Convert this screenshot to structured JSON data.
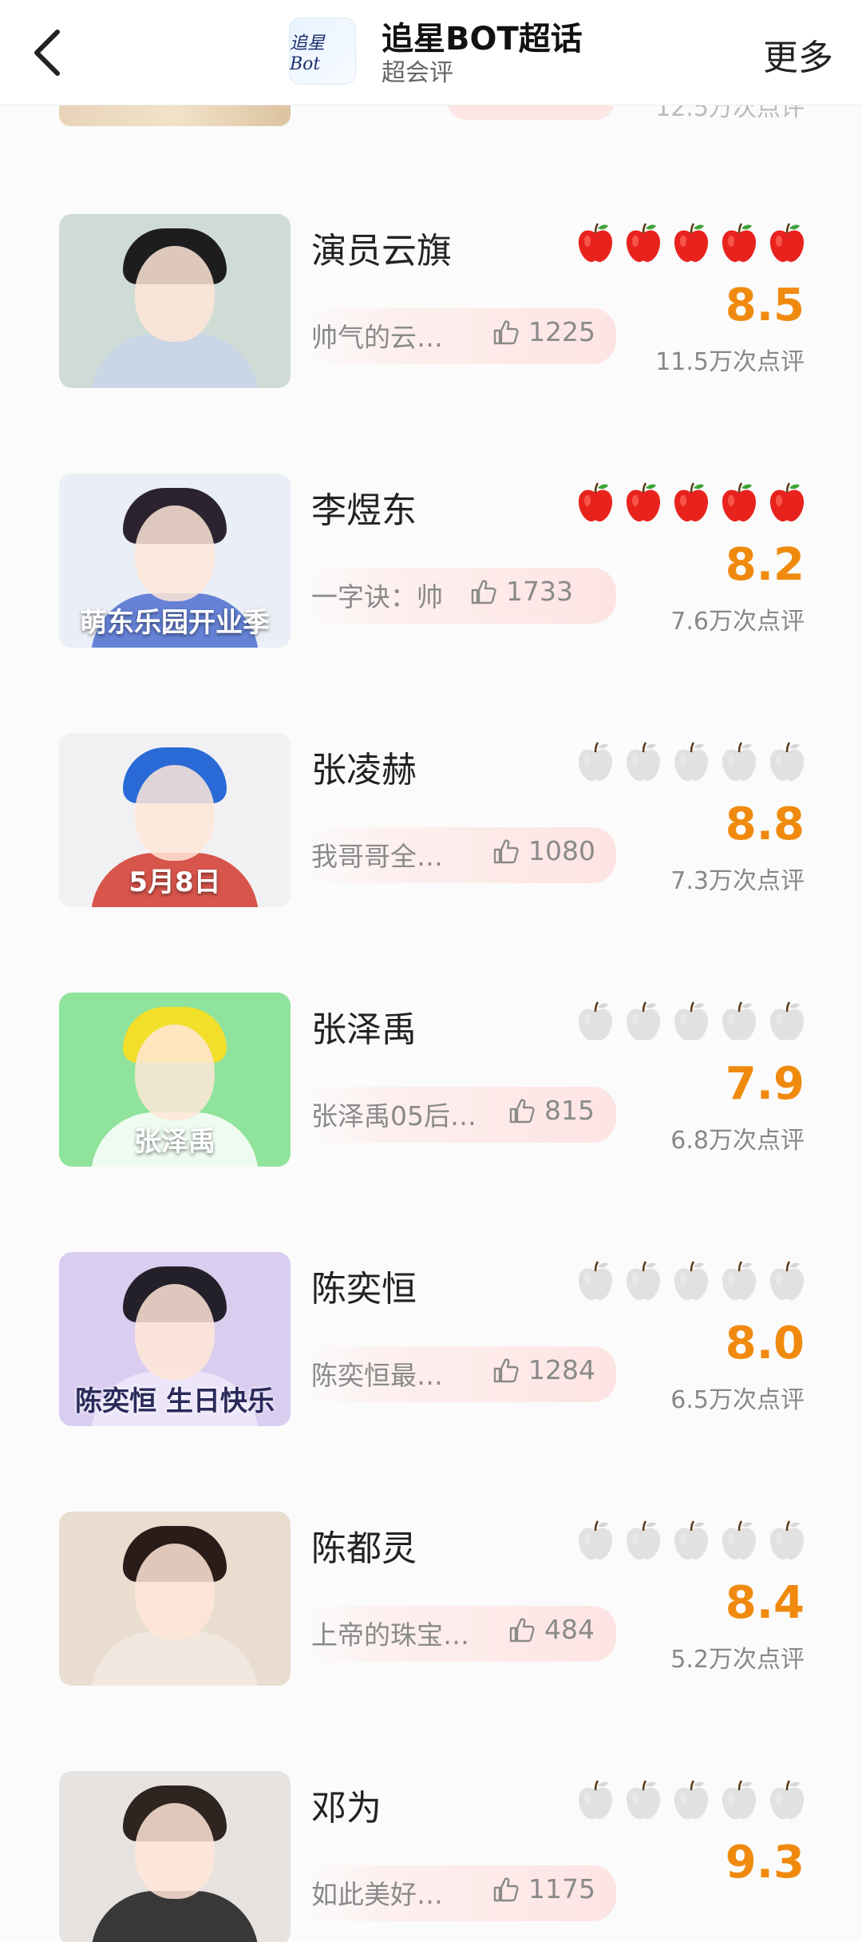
{
  "header": {
    "title": "追星BOT超话",
    "subtitle": "超会评",
    "more_label": "更多",
    "logo_text": "追星Bot"
  },
  "partial_item": {
    "reviews": "12.5万次点评"
  },
  "items": [
    {
      "name": "演员云旗",
      "apples_filled": 5,
      "review": "帅气的云…",
      "likes": "1225",
      "score": "8.5",
      "reviews": "11.5万次点评",
      "thumb_caption": "",
      "colors": {
        "bg": "#cfdcd6",
        "hair": "#1d1d1f",
        "body": "#c9d3e8"
      }
    },
    {
      "name": "李煜东",
      "apples_filled": 5,
      "review": "一字诀：帅",
      "likes": "1733",
      "score": "8.2",
      "reviews": "7.6万次点评",
      "thumb_caption": "萌东乐园开业季",
      "colors": {
        "bg": "#eaeef6",
        "hair": "#2b2430",
        "body": "#4d6fd0"
      }
    },
    {
      "name": "张凌赫",
      "apples_filled": 0,
      "review": "我哥哥全…",
      "likes": "1080",
      "score": "8.8",
      "reviews": "7.3万次点评",
      "thumb_caption": "5月8日",
      "colors": {
        "bg": "#f1f1f3",
        "hair": "#2a6ad6",
        "body": "#d43a2e"
      }
    },
    {
      "name": "张泽禹",
      "apples_filled": 0,
      "review": "张泽禹05后…",
      "likes": "815",
      "score": "7.9",
      "reviews": "6.8万次点评",
      "thumb_caption": "张泽禹",
      "colors": {
        "bg": "#8fe39c",
        "hair": "#f2df2a",
        "body": "#ffffff"
      }
    },
    {
      "name": "陈奕恒",
      "apples_filled": 0,
      "review": "陈奕恒最…",
      "likes": "1284",
      "score": "8.0",
      "reviews": "6.5万次点评",
      "thumb_caption": "陈奕恒 生日快乐",
      "colors": {
        "bg": "#d9cdf0",
        "hair": "#23202a",
        "body": "#efe9fa"
      }
    },
    {
      "name": "陈都灵",
      "apples_filled": 0,
      "review": "上帝的珠宝…",
      "likes": "484",
      "score": "8.4",
      "reviews": "5.2万次点评",
      "thumb_caption": "",
      "colors": {
        "bg": "#e9ddd0",
        "hair": "#2a1c18",
        "body": "#f3e9e2"
      }
    },
    {
      "name": "邓为",
      "apples_filled": 0,
      "review": "如此美好…",
      "likes": "1175",
      "score": "9.3",
      "reviews": "",
      "thumb_caption": "",
      "colors": {
        "bg": "#e6e2e0",
        "hair": "#2e2420",
        "body": "#1a1a1a"
      }
    }
  ]
}
